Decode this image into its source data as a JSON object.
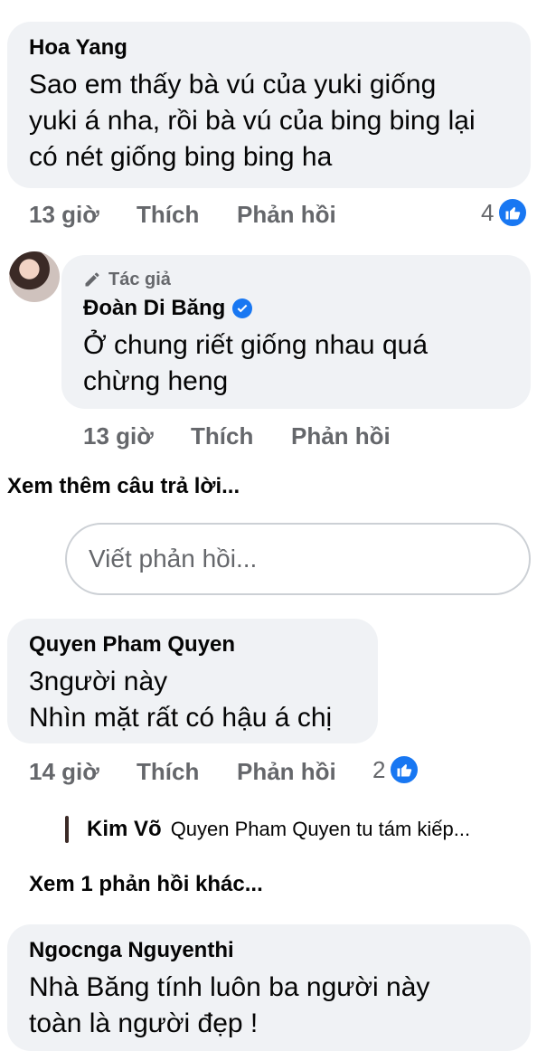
{
  "comments": [
    {
      "author": "Hoa Yang",
      "lines": [
        "Sao em thấy bà vú của yuki giống",
        "yuki á nha, rồi bà vú của bing bing lại",
        "có nét giống bing bing ha"
      ],
      "time": "13 giờ",
      "like": "Thích",
      "reply": "Phản hồi",
      "likes": "4"
    },
    {
      "badge": "Tác giả",
      "author": "Đoàn Di Băng",
      "lines": [
        "Ở chung riết giống nhau quá",
        "chừng heng"
      ],
      "time": "13 giờ",
      "like": "Thích",
      "reply": "Phản hồi"
    },
    {
      "author": "Quyen Pham Quyen",
      "lines": [
        "3người này",
        "Nhìn mặt rất có hậu á chị"
      ],
      "time": "14 giờ",
      "like": "Thích",
      "reply": "Phản hồi",
      "likes": "2"
    },
    {
      "author": "Ngocnga Nguyenthi",
      "lines": [
        "Nhà Băng tính luôn ba người này",
        "toàn là người đẹp !"
      ]
    }
  ],
  "see_more_replies": "Xem thêm câu trả lời...",
  "reply_placeholder": "Viết phản hồi...",
  "nested_reply": {
    "author": "Kim Võ",
    "text": "Quyen Pham Quyen tu tám kiếp..."
  },
  "see_one_more": "Xem 1 phản hồi khác...",
  "colors": {
    "bubble": "#f0f2f5",
    "meta": "#65676b",
    "like_blue": "#1877f2"
  }
}
